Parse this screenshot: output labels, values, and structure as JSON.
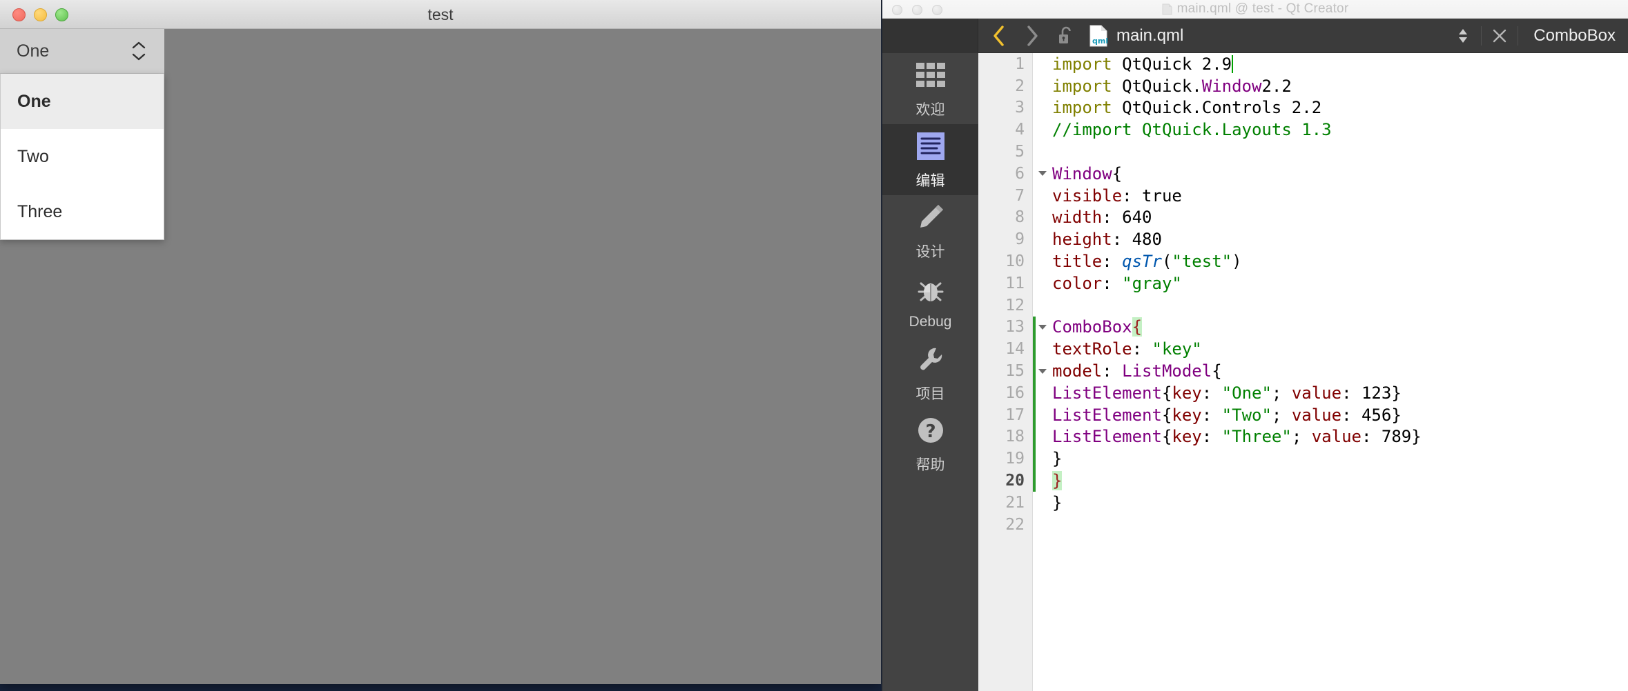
{
  "desktop": {
    "background_color": "#1d3152"
  },
  "qml_app": {
    "window_title": "test",
    "traffic_lights": [
      "close-red",
      "minimize-yellow",
      "zoom-green"
    ],
    "window_color": "gray",
    "combobox": {
      "selected_text": "One",
      "indicator_icon": "up-down-chevron-icon",
      "popup_open": true,
      "items": [
        {
          "label": "One",
          "highlighted": true
        },
        {
          "label": "Two",
          "highlighted": false
        },
        {
          "label": "Three",
          "highlighted": false
        }
      ]
    }
  },
  "qt_creator": {
    "window_title": "main.qml @ test - Qt Creator",
    "title_icon": "qml-file-icon",
    "toolbar": {
      "back_label": "‹",
      "forward_label": "›",
      "lock_icon": "unlocked-padlock-icon",
      "file_icon": "qml-file-icon",
      "file_name": "main.qml",
      "split_icon": "up-down-split-icon",
      "close_label": "✕",
      "symbol_name": "ComboBox"
    },
    "modes": [
      {
        "label": "欢迎",
        "icon": "grid-welcome-icon",
        "active": false
      },
      {
        "label": "编辑",
        "icon": "edit-lines-icon",
        "active": true
      },
      {
        "label": "设计",
        "icon": "pencil-design-icon",
        "active": false
      },
      {
        "label": "Debug",
        "icon": "bug-debug-icon",
        "active": false
      },
      {
        "label": "项目",
        "icon": "wrench-project-icon",
        "active": false
      },
      {
        "label": "帮助",
        "icon": "question-help-icon",
        "active": false
      }
    ],
    "editor": {
      "current_line": 20,
      "total_lines": 22,
      "line_numbers": [
        1,
        2,
        3,
        4,
        5,
        6,
        7,
        8,
        9,
        10,
        11,
        12,
        13,
        14,
        15,
        16,
        17,
        18,
        19,
        20,
        21,
        22
      ],
      "fold_lines": [
        6,
        13,
        15
      ],
      "change_bar_lines": [
        13,
        14,
        15,
        16,
        17,
        18,
        19,
        20
      ],
      "code_lines": [
        "import QtQuick 2.9",
        "import QtQuick.Window 2.2",
        "import QtQuick.Controls 2.2",
        "//import QtQuick.Layouts 1.3",
        "",
        "Window {",
        "    visible: true",
        "    width: 640",
        "    height: 480",
        "    title: qsTr(\"test\")",
        "    color: \"gray\"",
        "",
        "    ComboBox {",
        "        textRole: \"key\"",
        "        model: ListModel {",
        "            ListElement { key: \"One\"; value: 123 }",
        "            ListElement { key: \"Two\"; value: 456 }",
        "            ListElement { key: \"Three\"; value: 789 }",
        "        }",
        "    }",
        "}",
        ""
      ]
    }
  },
  "colors": {
    "accent_yellow": "#f2c12e",
    "keyword_import": "#808000",
    "comment_green": "#008000",
    "type_purple": "#800080",
    "property_dark_red": "#800000",
    "string_green": "#008000",
    "function_blue": "#0057ae",
    "change_bar_green": "#2e9b2e",
    "brace_highlight": "#c4f0c4",
    "mode_active_bg": "#333333",
    "editor_bg": "#ffffff",
    "gutter_bg": "#eeeeee"
  }
}
